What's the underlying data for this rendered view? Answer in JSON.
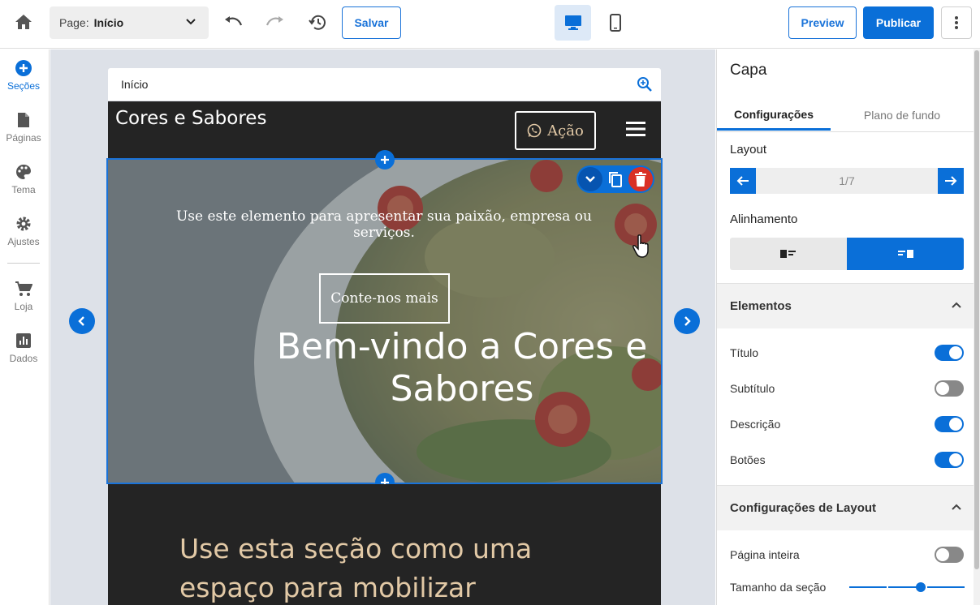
{
  "topbar": {
    "page_label": "Page:",
    "page_value": "Início",
    "save_label": "Salvar",
    "preview_label": "Preview",
    "publish_label": "Publicar"
  },
  "sidebar": {
    "items": [
      {
        "label": "Seções",
        "icon": "plus-circle-icon"
      },
      {
        "label": "Páginas",
        "icon": "page-icon"
      },
      {
        "label": "Tema",
        "icon": "palette-icon"
      },
      {
        "label": "Ajustes",
        "icon": "gear-icon"
      },
      {
        "label": "Loja",
        "icon": "cart-icon"
      },
      {
        "label": "Dados",
        "icon": "chart-icon"
      }
    ]
  },
  "preview": {
    "address": "Início",
    "site_title": "Cores e Sabores",
    "action_label": "Ação",
    "hero_description": "Use este elemento para apresentar sua paixão, empresa ou serviços.",
    "hero_button": "Conte-nos mais",
    "hero_title": "Bem-vindo a Cores e Sabores",
    "section_text": "Use esta seção como uma espaço para mobilizar"
  },
  "panel": {
    "title": "Capa",
    "tabs": [
      "Configurações",
      "Plano de fundo"
    ],
    "layout_label": "Layout",
    "layout_value": "1/7",
    "alignment_label": "Alinhamento",
    "elements_header": "Elementos",
    "elements": [
      {
        "label": "Título",
        "on": true
      },
      {
        "label": "Subtítulo",
        "on": false
      },
      {
        "label": "Descrição",
        "on": true
      },
      {
        "label": "Botões",
        "on": true
      }
    ],
    "layout_settings_header": "Configurações de Layout",
    "full_page_label": "Página inteira",
    "full_page_on": false,
    "section_size_label": "Tamanho da seção",
    "section_size_level": 0.62
  },
  "colors": {
    "accent": "#0a6fd8",
    "delete": "#d93025",
    "site_dark": "#242424",
    "site_accent_text": "#e2c9a6"
  }
}
